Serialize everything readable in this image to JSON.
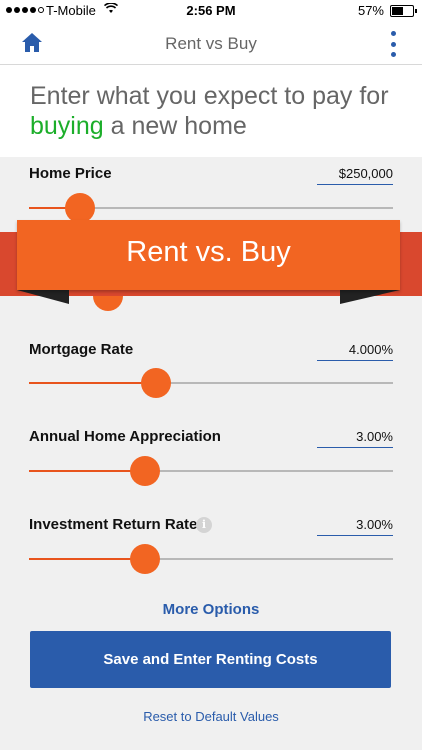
{
  "status_bar": {
    "carrier": "T-Mobile",
    "time": "2:56 PM",
    "battery": "57%",
    "battery_level": 0.57
  },
  "nav": {
    "title": "Rent vs Buy",
    "home_icon": "home-icon",
    "menu_icon": "more-vertical-icon",
    "accent": "#2a5cab"
  },
  "headline": {
    "prefix": "Enter what you expect to pay for ",
    "highlight": "buying",
    "suffix": " a new home",
    "highlight_color": "#1cae2a"
  },
  "banner": {
    "text": "Rent vs. Buy",
    "color": "#f26522"
  },
  "fields": [
    {
      "label": "Home Price",
      "value": "$250,000",
      "slider_level": 0.14
    },
    {
      "label": "Mortgage Rate",
      "value": "4.000%",
      "slider_level": 0.35
    },
    {
      "label": "Annual Home Appreciation",
      "value": "3.00%",
      "slider_level": 0.32
    },
    {
      "label": "Investment Return Rate",
      "value": "3.00%",
      "slider_level": 0.32,
      "info_icon": "i"
    }
  ],
  "more_options": "More Options",
  "primary_button": "Save and Enter Renting Costs",
  "reset_link": "Reset to Default Values"
}
